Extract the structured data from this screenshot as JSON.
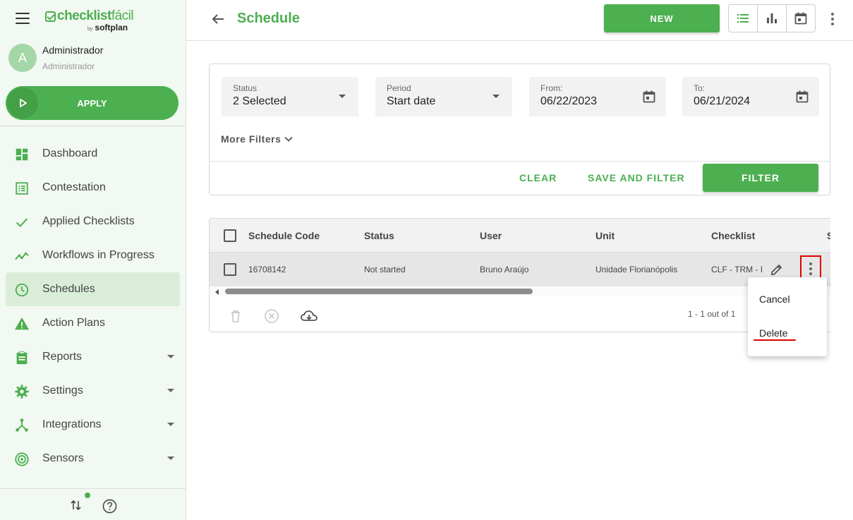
{
  "brand": {
    "logo_main": "checklist",
    "logo_main_suffix": "fácil",
    "logo_by": "by",
    "logo_company": "softplan"
  },
  "user": {
    "initial": "A",
    "name": "Administrador",
    "role": "Administrador"
  },
  "apply_button": {
    "label": "APPLY"
  },
  "nav": [
    {
      "label": "Dashboard",
      "icon": "dashboard-icon"
    },
    {
      "label": "Contestation",
      "icon": "list-icon"
    },
    {
      "label": "Applied Checklists",
      "icon": "check-icon"
    },
    {
      "label": "Workflows in Progress",
      "icon": "trend-icon"
    },
    {
      "label": "Schedules",
      "icon": "clock-icon",
      "active": true
    },
    {
      "label": "Action Plans",
      "icon": "warning-icon"
    },
    {
      "label": "Reports",
      "icon": "clipboard-icon",
      "expandable": true
    },
    {
      "label": "Settings",
      "icon": "gear-icon",
      "expandable": true
    },
    {
      "label": "Integrations",
      "icon": "integrations-icon",
      "expandable": true
    },
    {
      "label": "Sensors",
      "icon": "sensor-icon",
      "expandable": true
    }
  ],
  "header": {
    "title": "Schedule",
    "new_label": "NEW"
  },
  "filters": {
    "status": {
      "label": "Status",
      "value": "2 Selected"
    },
    "period": {
      "label": "Period",
      "value": "Start date"
    },
    "from": {
      "label": "From:",
      "value": "06/22/2023"
    },
    "to": {
      "label": "To:",
      "value": "06/21/2024"
    },
    "more_filters": "More Filters",
    "clear_label": "CLEAR",
    "save_filter_label": "SAVE AND FILTER",
    "filter_label": "FILTER"
  },
  "table": {
    "columns": [
      "Schedule Code",
      "Status",
      "User",
      "Unit",
      "Checklist",
      "S"
    ],
    "rows": [
      {
        "code": "16708142",
        "status": "Not started",
        "user": "Bruno Araújo",
        "unit": "Unidade Florianópolis",
        "checklist": "CLF - TRM - I"
      }
    ],
    "pagination": "1 - 1 out of 1"
  },
  "context_menu": {
    "items": [
      "Cancel",
      "Delete"
    ]
  },
  "colors": {
    "primary": "#4caf50",
    "highlight": "#e00000"
  }
}
